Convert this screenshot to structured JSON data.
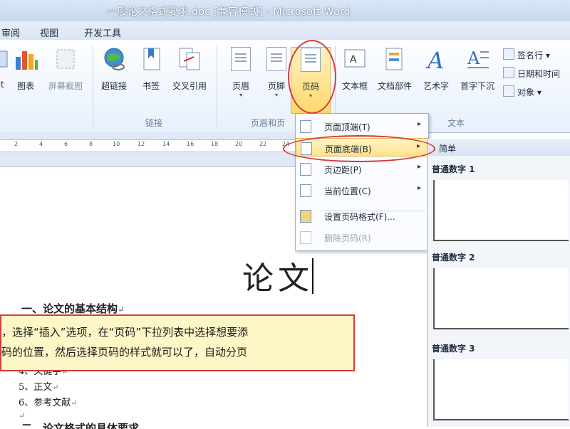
{
  "window": {
    "title": "一般论文格式要求.doc [兼容模式] - Microsoft Word"
  },
  "tabs": [
    "审阅",
    "视图",
    "开发工具"
  ],
  "ribbon": {
    "buttons": [
      {
        "label": "ct",
        "icon": "smartart-icon"
      },
      {
        "label": "图表",
        "icon": "chart-icon"
      },
      {
        "label": "屏幕截图",
        "icon": "screenshot-icon"
      },
      {
        "label": "超链接",
        "icon": "globe-link-icon"
      },
      {
        "label": "书签",
        "icon": "bookmark-icon"
      },
      {
        "label": "交叉引用",
        "icon": "cross-reference-icon"
      },
      {
        "label": "页眉",
        "icon": "header-icon"
      },
      {
        "label": "页脚",
        "icon": "footer-icon"
      },
      {
        "label": "页码",
        "icon": "page-number-icon"
      },
      {
        "label": "文本框",
        "icon": "textbox-icon"
      },
      {
        "label": "文档部件",
        "icon": "quick-parts-icon"
      },
      {
        "label": "艺术字",
        "icon": "wordart-icon"
      },
      {
        "label": "首字下沉",
        "icon": "drop-cap-icon"
      }
    ],
    "small_items": [
      "签名行",
      "日期和时间",
      "对象"
    ],
    "groups": [
      "链接",
      "页眉和页",
      "文本"
    ]
  },
  "ruler": {
    "ticks": [
      "2",
      "4",
      "6",
      "8",
      "10",
      "12",
      "14",
      "16",
      "18",
      "20",
      "22",
      "24"
    ]
  },
  "document": {
    "title": "论文",
    "heading1": "一、论文的基本结构",
    "list_items": [
      "4、关键字",
      "5、正文",
      "6、参考文献"
    ],
    "heading2": "二、论文格式的具体要求"
  },
  "callout": {
    "line1": "，选择“插入”选项，在“页码”下拉列表中选择想要添",
    "line2": "码的位置，然后选择页码的样式就可以了，自动分页"
  },
  "menu": {
    "items": [
      {
        "label": "页面顶端(T)",
        "has_submenu": true,
        "state": "normal"
      },
      {
        "label": "页面底端(B)",
        "has_submenu": true,
        "state": "hover"
      },
      {
        "label": "页边距(P)",
        "has_submenu": true,
        "state": "normal"
      },
      {
        "label": "当前位置(C)",
        "has_submenu": true,
        "state": "normal"
      },
      {
        "label": "设置页码格式(F)...",
        "has_submenu": false,
        "state": "normal"
      },
      {
        "label": "删除页码(R)",
        "has_submenu": false,
        "state": "disabled"
      }
    ],
    "submenu_arrow": "▸"
  },
  "gallery": {
    "header": "简单",
    "items": [
      "普通数字 1",
      "普通数字 2",
      "普通数字 3"
    ]
  },
  "colors": {
    "annotation_red": "#d43b3b",
    "hover": "#ffe18a",
    "callout_bg": "#fdf6c6"
  }
}
